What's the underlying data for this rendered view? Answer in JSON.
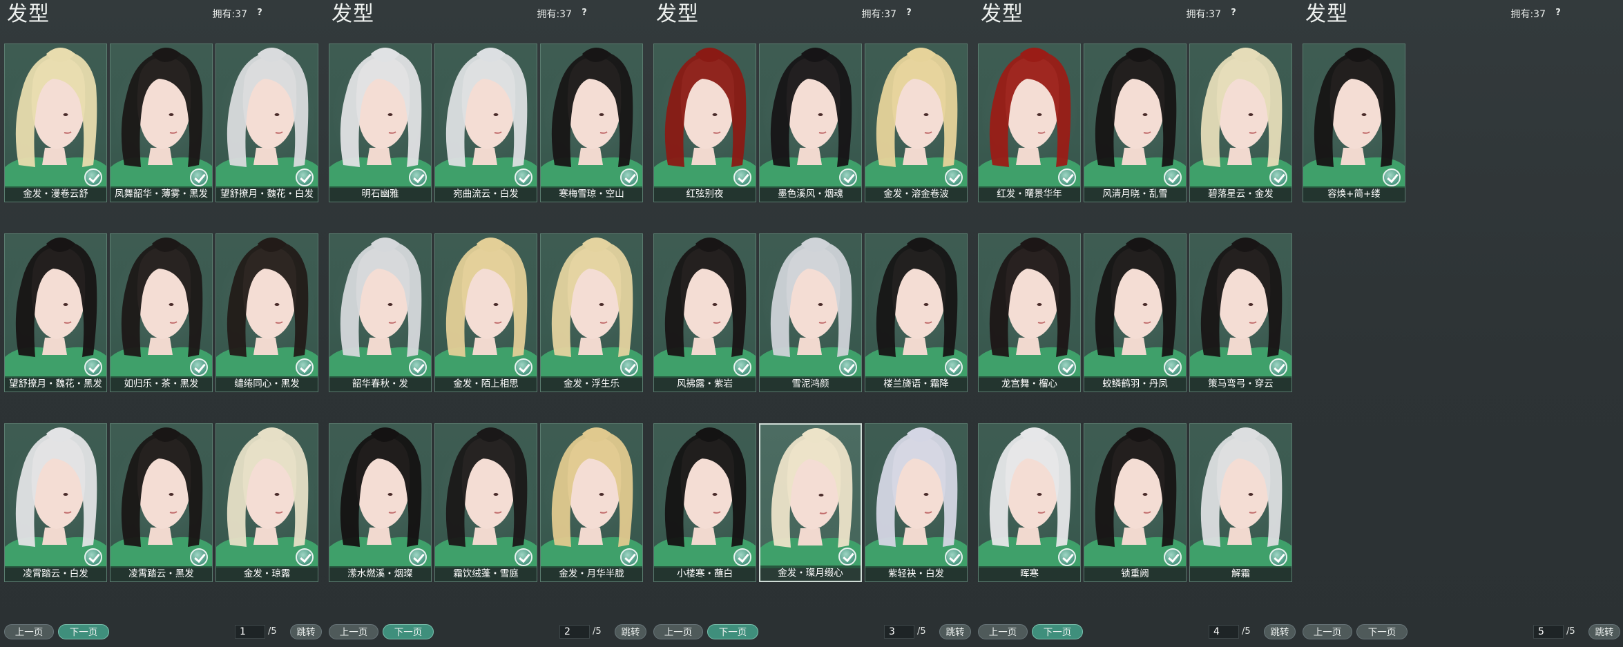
{
  "colors": {
    "background": "#2e3436",
    "card": "#3a5a50",
    "card_border": "#5b7d70",
    "accent_button": "#3f8f7c",
    "check": "#4d9a83"
  },
  "panels": [
    {
      "title": "发型",
      "owned": "拥有:37",
      "help": "?",
      "items": [
        {
          "label": "金发・漫卷云舒",
          "hair": "#e8dcae",
          "owned": true,
          "selected": false
        },
        {
          "label": "凤舞韶华・薄雾・黑发",
          "hair": "#1a1716",
          "owned": true,
          "selected": false
        },
        {
          "label": "望舒撩月・魏花・白发",
          "hair": "#d9dbdd",
          "owned": true,
          "selected": false
        },
        {
          "label": "望舒撩月・魏花・黑发",
          "hair": "#171414",
          "owned": true,
          "selected": false
        },
        {
          "label": "如归乐・茶・黑发",
          "hair": "#1c1817",
          "owned": true,
          "selected": false
        },
        {
          "label": "缱绻同心・黑发",
          "hair": "#221b18",
          "owned": true,
          "selected": false
        },
        {
          "label": "凌霄踏云・白发",
          "hair": "#e2e3e5",
          "owned": true,
          "selected": false
        },
        {
          "label": "凌霄踏云・黑发",
          "hair": "#191615",
          "owned": true,
          "selected": false
        },
        {
          "label": "金发・琼露",
          "hair": "#e6dfc6",
          "owned": true,
          "selected": false
        }
      ],
      "pager": {
        "prev": "上一页",
        "next": "下一页",
        "page": "1",
        "total": "/5",
        "jump": "跳转"
      }
    },
    {
      "title": "发型",
      "owned": "拥有:37",
      "help": "?",
      "items": [
        {
          "label": "明石幽雅",
          "hair": "#e0e2e4",
          "owned": true,
          "selected": false
        },
        {
          "label": "宛曲流云・白发",
          "hair": "#dcdfe2",
          "owned": true,
          "selected": false
        },
        {
          "label": "寒梅雪琼・空山",
          "hair": "#171515",
          "owned": true,
          "selected": false
        },
        {
          "label": "韶华春秋・发",
          "hair": "#d5d8db",
          "owned": true,
          "selected": false
        },
        {
          "label": "金发・陌上相思",
          "hair": "#e3cf97",
          "owned": true,
          "selected": false
        },
        {
          "label": "金发・浮生乐",
          "hair": "#e4d39f",
          "owned": true,
          "selected": false
        },
        {
          "label": "潆水燃溪・烟璨",
          "hair": "#141212",
          "owned": true,
          "selected": false
        },
        {
          "label": "霜饮绒蓬・雪庭",
          "hair": "#1a1818",
          "owned": true,
          "selected": false
        },
        {
          "label": "金发・月华半胧",
          "hair": "#e0c98e",
          "owned": true,
          "selected": false
        }
      ],
      "pager": {
        "prev": "上一页",
        "next": "下一页",
        "page": "2",
        "total": "/5",
        "jump": "跳转"
      }
    },
    {
      "title": "发型",
      "owned": "拥有:37",
      "help": "?",
      "items": [
        {
          "label": "红弦别夜",
          "hair": "#8a1a14",
          "owned": true,
          "selected": false
        },
        {
          "label": "墨色溪风・烟魂",
          "hair": "#161416",
          "owned": true,
          "selected": false
        },
        {
          "label": "金发・溶金卷波",
          "hair": "#e6d39a",
          "owned": true,
          "selected": false
        },
        {
          "label": "风拂露・紫岩",
          "hair": "#181515",
          "owned": true,
          "selected": false
        },
        {
          "label": "雪泥鸿颜",
          "hair": "#cfd3d8",
          "owned": true,
          "selected": false
        },
        {
          "label": "楼兰旖语・霜降",
          "hair": "#161515",
          "owned": true,
          "selected": false
        },
        {
          "label": "小楼寒・蘸白",
          "hair": "#141313",
          "owned": true,
          "selected": false
        },
        {
          "label": "金发・璨月缀心",
          "hair": "#ece3c8",
          "owned": true,
          "selected": true
        },
        {
          "label": "紫轻袂・白发",
          "hair": "#d4d6e4",
          "owned": true,
          "selected": false
        }
      ],
      "pager": {
        "prev": "上一页",
        "next": "下一页",
        "page": "3",
        "total": "/5",
        "jump": "跳转"
      }
    },
    {
      "title": "发型",
      "owned": "拥有:37",
      "help": "?",
      "items": [
        {
          "label": "红发・曙景华年",
          "hair": "#9a1c16",
          "owned": true,
          "selected": false
        },
        {
          "label": "风清月晓・乱雪",
          "hair": "#161414",
          "owned": true,
          "selected": false
        },
        {
          "label": "碧落星云・金发",
          "hair": "#e5dcb8",
          "owned": true,
          "selected": false
        },
        {
          "label": "龙宫舞・榴心",
          "hair": "#1c1616",
          "owned": true,
          "selected": false
        },
        {
          "label": "蛟鳞鹤羽・丹凤",
          "hair": "#161414",
          "owned": true,
          "selected": false
        },
        {
          "label": "策马弯弓・穿云",
          "hair": "#181515",
          "owned": true,
          "selected": false
        },
        {
          "label": "晖寒",
          "hair": "#e6e7e9",
          "owned": true,
          "selected": false
        },
        {
          "label": "锁重阙",
          "hair": "#171414",
          "owned": true,
          "selected": false
        },
        {
          "label": "解霜",
          "hair": "#dcdee0",
          "owned": true,
          "selected": false
        }
      ],
      "pager": {
        "prev": "上一页",
        "next": "下一页",
        "page": "4",
        "total": "/5",
        "jump": "跳转"
      }
    },
    {
      "title": "发型",
      "owned": "拥有:37",
      "help": "?",
      "items": [
        {
          "label": "容焕+简+缕",
          "hair": "#161414",
          "owned": true,
          "selected": false
        }
      ],
      "pager": {
        "prev": "上一页",
        "next": "下一页",
        "page": "5",
        "total": "/5",
        "jump": "跳转"
      }
    }
  ]
}
